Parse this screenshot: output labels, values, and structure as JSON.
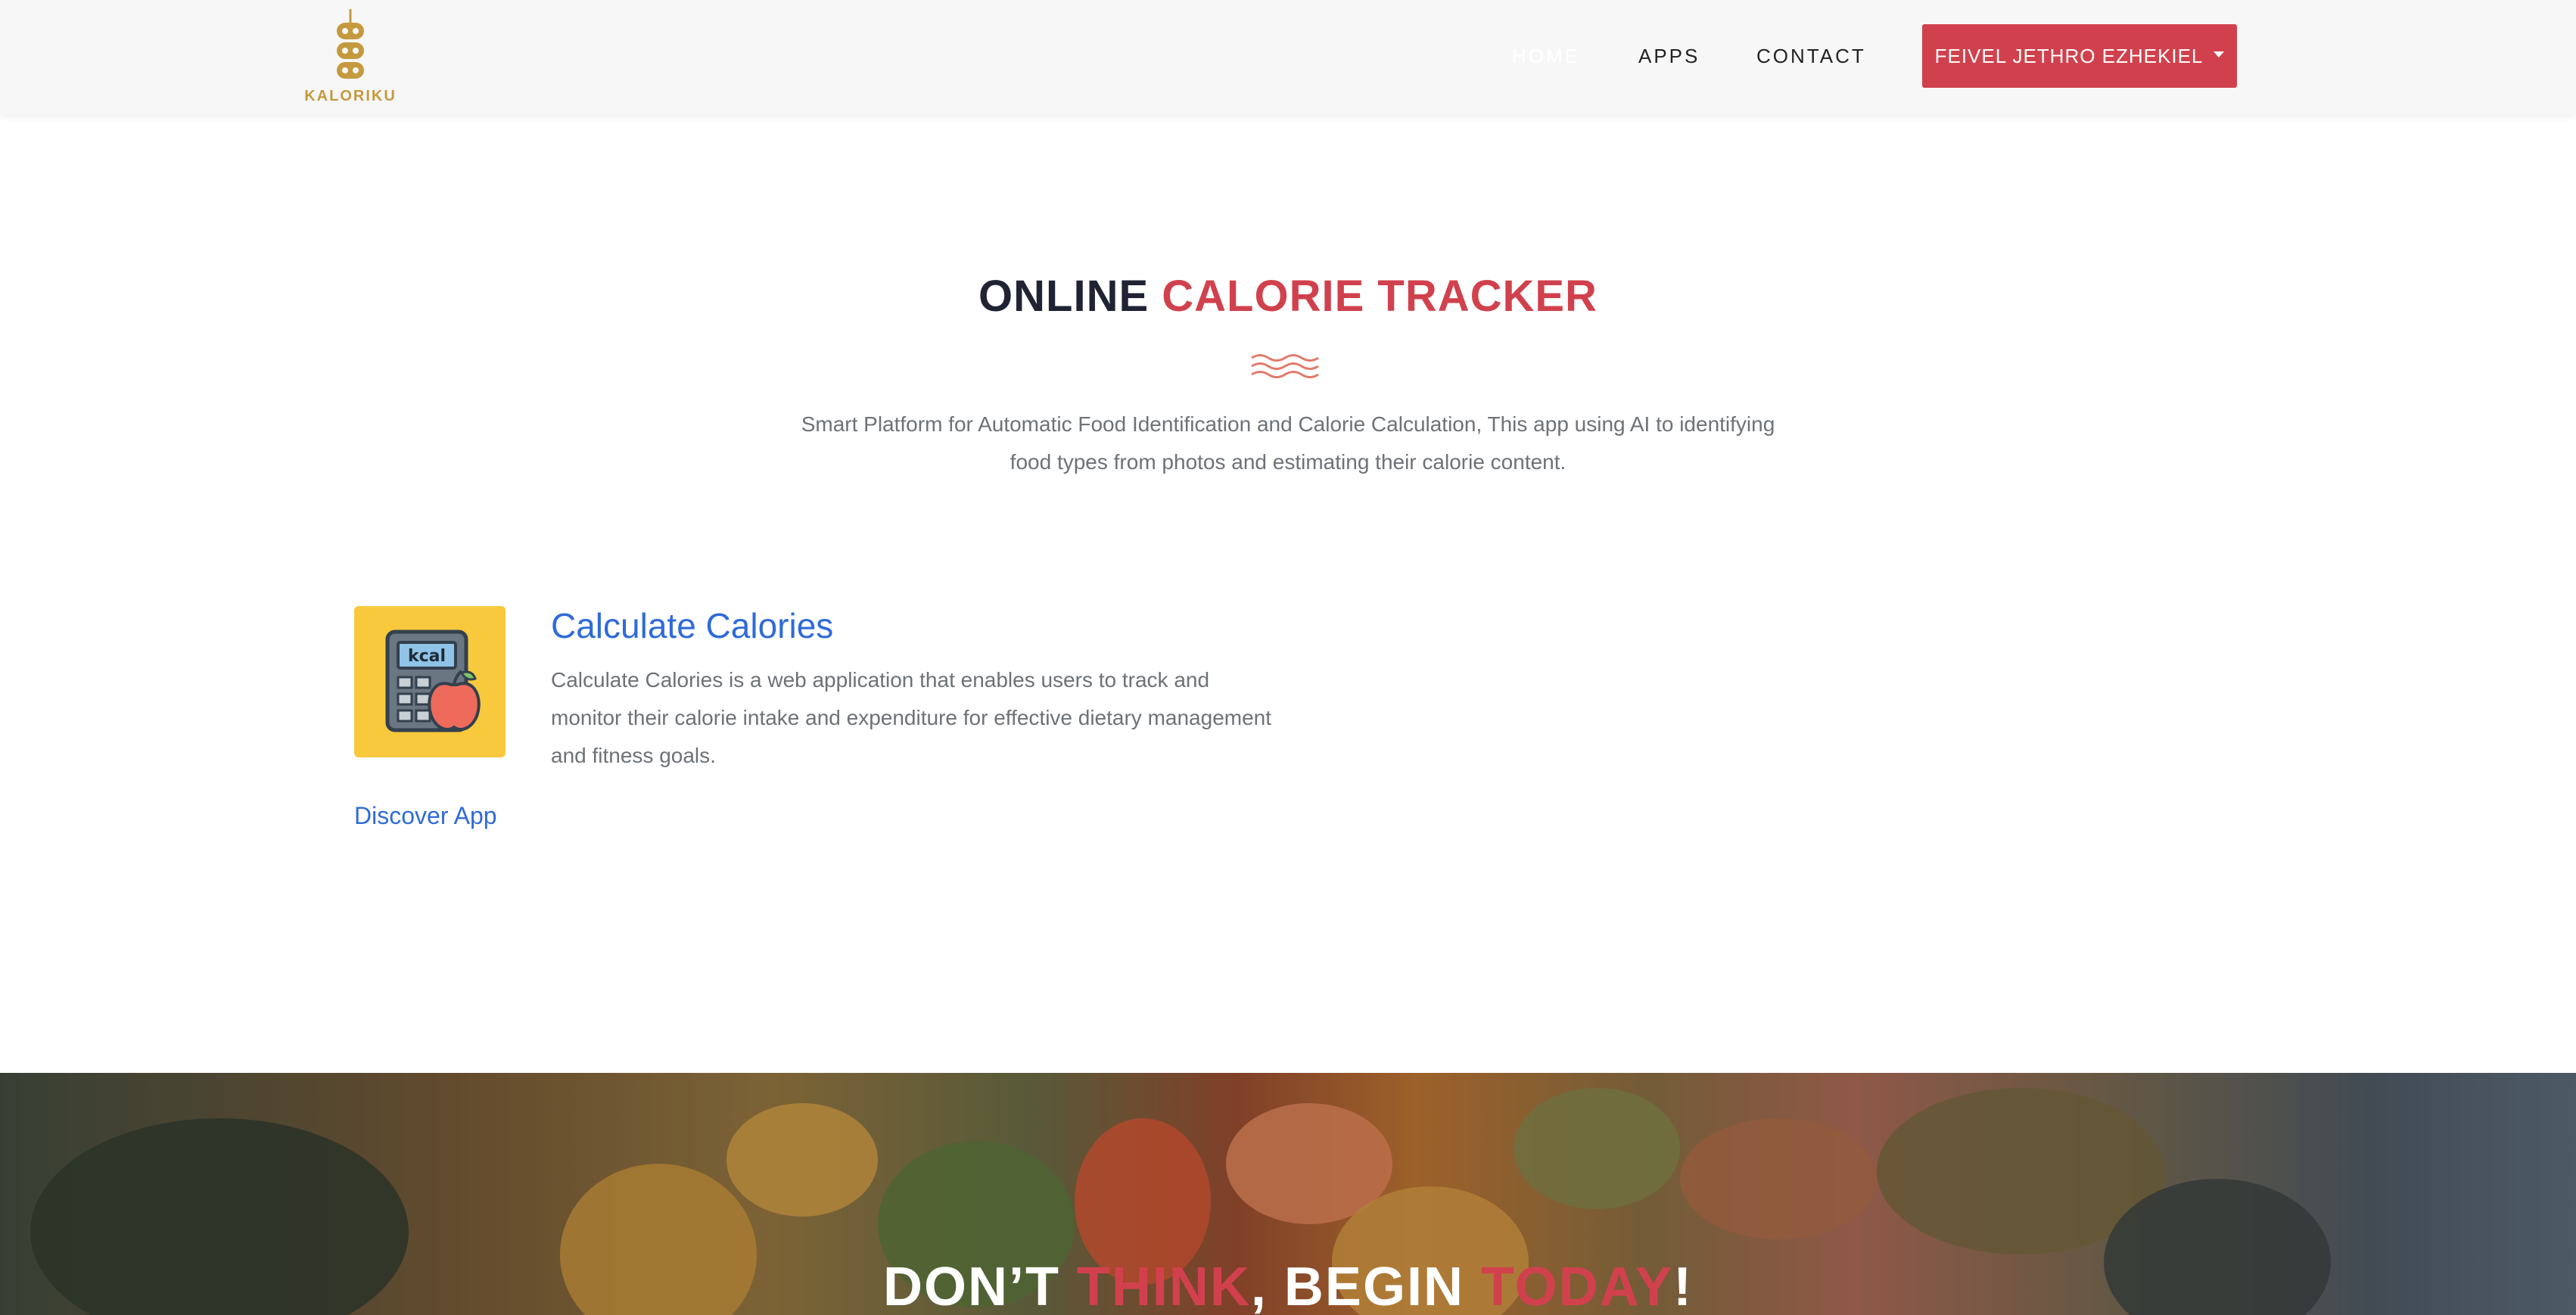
{
  "header": {
    "brand": "KALORIKU",
    "nav": {
      "home": "HOME",
      "apps": "APPS",
      "contact": "CONTACT"
    },
    "user_name": "FEIVEL JETHRO EZHEKIEL"
  },
  "hero": {
    "title_part1": "ONLINE ",
    "title_part2": "CALORIE TRACKER",
    "description": "Smart Platform for Automatic Food Identification and Calorie Calculation, This app using AI to identifying food types from photos and estimating their calorie content."
  },
  "app_card": {
    "icon_label": "kcal",
    "title": "Calculate Calories",
    "description": "Calculate Calories is a web application that enables users to track and monitor their calorie intake and expenditure for effective dietary management and fitness goals.",
    "link": "Discover App"
  },
  "banner": {
    "part1": "DON’T ",
    "part2": "THINK",
    "part3": ", BEGIN ",
    "part4": "TODAY",
    "part5": "!"
  },
  "colors": {
    "accent_red": "#d1414d",
    "link_blue": "#2f6bd9",
    "logo_gold": "#c59a3e",
    "icon_bg": "#f8c93d"
  }
}
